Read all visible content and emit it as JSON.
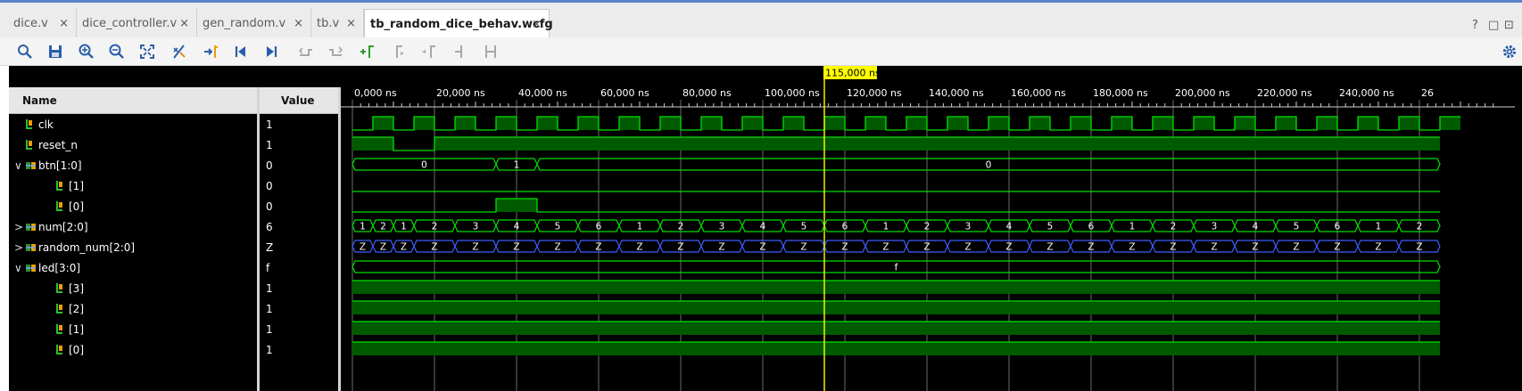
{
  "tabs": [
    {
      "label": "dice.v",
      "active": false
    },
    {
      "label": "dice_controller.v",
      "active": false
    },
    {
      "label": "gen_random.v",
      "active": false
    },
    {
      "label": "tb.v",
      "active": false
    },
    {
      "label": "tb_random_dice_behav.wcfg",
      "active": true
    }
  ],
  "tab_close_glyph": "×",
  "window_controls": [
    "?",
    "□",
    "⊡"
  ],
  "toolbar_icons": [
    "search-icon",
    "save-icon",
    "zoom-in-icon",
    "zoom-out-icon",
    "zoom-fit-icon",
    "swap-cursor-icon",
    "go-to-cursor-icon",
    "go-to-start-icon",
    "go-to-end-icon",
    "previous-transition-icon",
    "next-transition-icon",
    "add-marker-icon",
    "previous-marker-icon",
    "next-marker-icon",
    "swap-markers-icon",
    "unused-icon",
    "settings-gear-icon"
  ],
  "header": {
    "name": "Name",
    "value": "Value"
  },
  "cursor": {
    "label": "115,000 ns",
    "time_ns": 115000
  },
  "time_axis": {
    "ticks": [
      "0,000 ns",
      "20,000 ns",
      "40,000 ns",
      "60,000 ns",
      "80,000 ns",
      "100,000 ns",
      "120,000 ns",
      "140,000 ns",
      "160,000 ns",
      "180,000 ns",
      "200,000 ns",
      "220,000 ns",
      "240,000 ns",
      "26"
    ]
  },
  "colors": {
    "wave": "#00e000",
    "wave_fill": "#005a00",
    "highz": "#3c5dff",
    "cursor": "#ffff00",
    "text": "#ffffff"
  },
  "signals": [
    {
      "name": "clk",
      "value": "1",
      "expander": "",
      "icon": "bit"
    },
    {
      "name": "reset_n",
      "value": "1",
      "expander": "",
      "icon": "bit"
    },
    {
      "name": "btn[1:0]",
      "value": "0",
      "expander": "∨",
      "icon": "bus"
    },
    {
      "name": "[1]",
      "value": "0",
      "expander": "",
      "icon": "bit"
    },
    {
      "name": "[0]",
      "value": "0",
      "expander": "",
      "icon": "bit"
    },
    {
      "name": "num[2:0]",
      "value": "6",
      "expander": ">",
      "icon": "bus"
    },
    {
      "name": "random_num[2:0]",
      "value": "Z",
      "expander": ">",
      "icon": "bus"
    },
    {
      "name": "led[3:0]",
      "value": "f",
      "expander": "∨",
      "icon": "bus"
    },
    {
      "name": "[3]",
      "value": "1",
      "expander": "",
      "icon": "bit"
    },
    {
      "name": "[2]",
      "value": "1",
      "expander": "",
      "icon": "bit"
    },
    {
      "name": "[1]",
      "value": "1",
      "expander": "",
      "icon": "bit"
    },
    {
      "name": "[0]",
      "value": "1",
      "expander": "",
      "icon": "bit"
    }
  ],
  "waves": {
    "btn_labels": [
      "0",
      "1",
      "0"
    ],
    "num_labels": [
      "1",
      "2",
      "1",
      "2",
      "3",
      "4",
      "5",
      "6",
      "1",
      "2",
      "3",
      "4",
      "5",
      "6",
      "1",
      "2",
      "3",
      "4",
      "5",
      "6",
      "1",
      "2",
      "3",
      "4",
      "5",
      "6",
      "1",
      "2"
    ],
    "random_labels": [
      "Z",
      "Z",
      "Z",
      "Z",
      "Z",
      "Z",
      "Z",
      "Z",
      "Z",
      "Z",
      "Z",
      "Z",
      "Z",
      "Z",
      "Z",
      "Z",
      "Z",
      "Z",
      "Z",
      "Z",
      "Z",
      "Z",
      "Z",
      "Z",
      "Z",
      "Z",
      "Z",
      "Z"
    ],
    "led_label": "f"
  }
}
